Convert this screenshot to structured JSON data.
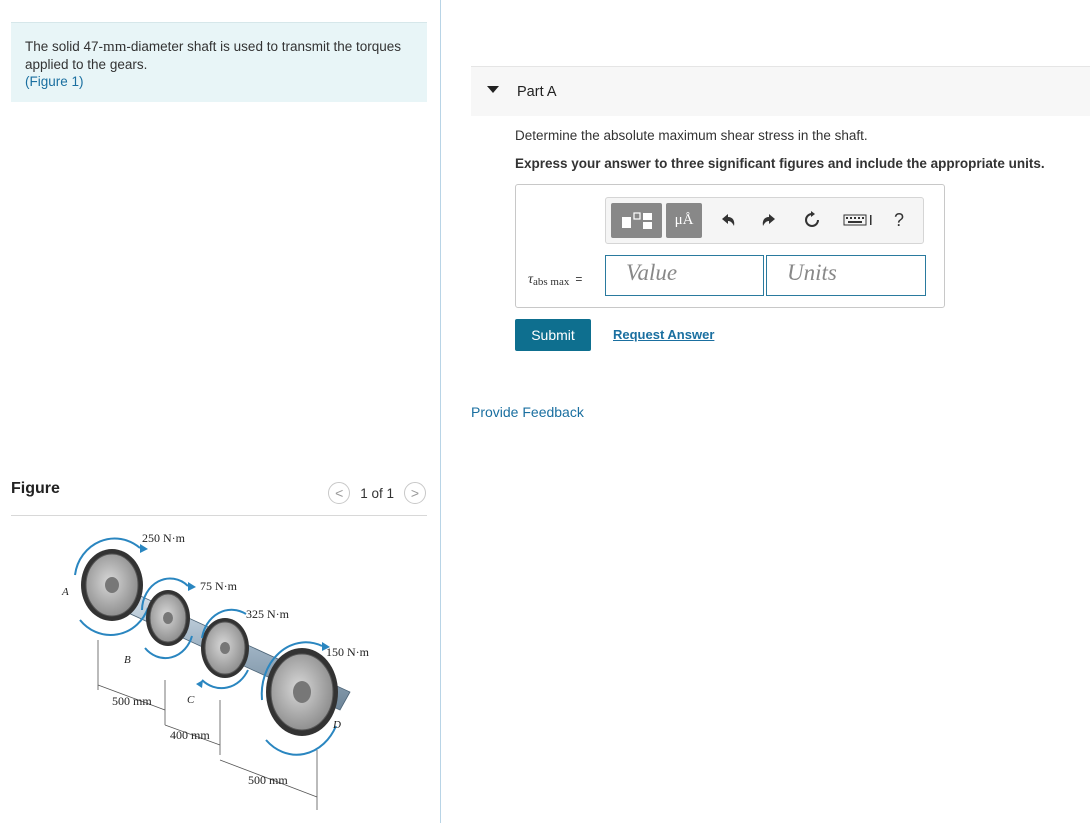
{
  "problem": {
    "text_before": "The solid 47-",
    "unit_mm": "mm",
    "text_after": "-diameter shaft is used to transmit the torques applied to the gears.",
    "figure_link": "(Figure 1)"
  },
  "figure_panel": {
    "title": "Figure",
    "page_indicator": "1 of 1",
    "prev_label": "<",
    "next_label": ">",
    "labels": {
      "t1": "250 N·m",
      "t2": "75 N·m",
      "t3": "325 N·m",
      "t4": "150 N·m",
      "pointA": "A",
      "pointB": "B",
      "pointC": "C",
      "pointD": "D",
      "d1": "500 mm",
      "d2": "400 mm",
      "d3": "500 mm"
    }
  },
  "part": {
    "title": "Part A",
    "question": "Determine the absolute maximum shear stress in the shaft.",
    "instruction": "Express your answer to three significant figures and include the appropriate units."
  },
  "answer": {
    "tau_symbol": "τ",
    "tau_sub": "abs max",
    "equals": "=",
    "value_placeholder": "Value",
    "units_placeholder": "Units"
  },
  "toolbar": {
    "units_button": "μÅ",
    "help": "?"
  },
  "actions": {
    "submit": "Submit",
    "request_answer": "Request Answer",
    "provide_feedback": "Provide Feedback"
  }
}
